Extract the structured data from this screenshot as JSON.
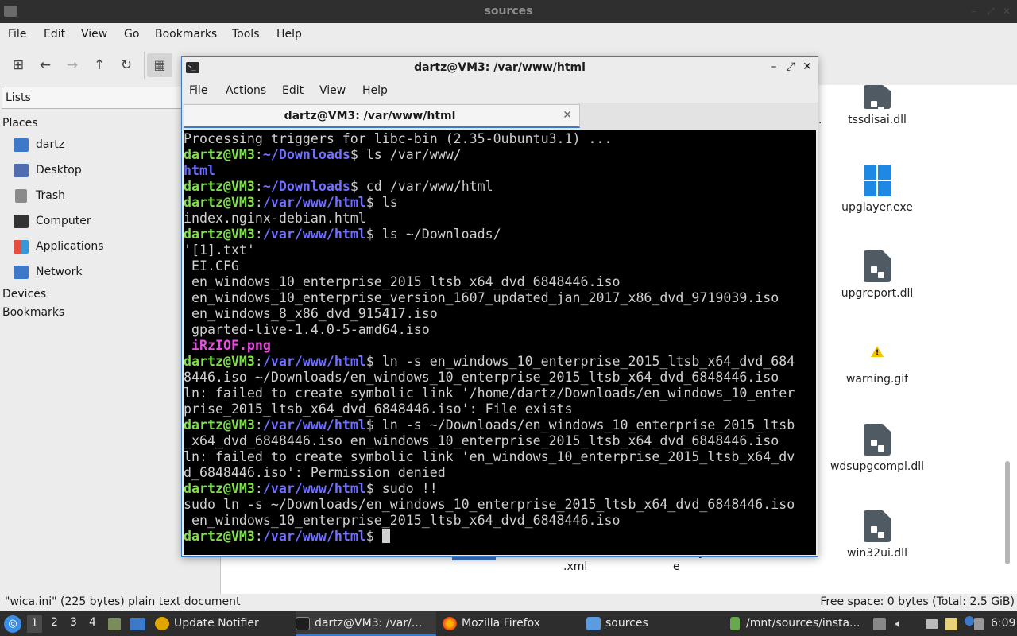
{
  "file_manager": {
    "title": "sources",
    "menu": [
      "File",
      "Edit",
      "View",
      "Go",
      "Bookmarks",
      "Tools",
      "Help"
    ],
    "sidebar": {
      "mode": "Lists",
      "places_heading": "Places",
      "places": [
        {
          "label": "dartz",
          "icon": "home-folder-icon"
        },
        {
          "label": "Desktop",
          "icon": "desktop-icon"
        },
        {
          "label": "Trash",
          "icon": "trash-icon"
        },
        {
          "label": "Computer",
          "icon": "computer-icon"
        },
        {
          "label": "Applications",
          "icon": "applications-icon"
        },
        {
          "label": "Network",
          "icon": "network-icon"
        }
      ],
      "devices_heading": "Devices",
      "bookmarks_heading": "Bookmarks"
    },
    "files": [
      {
        "name": "tssdisai.dll",
        "icon": "dll-file-icon"
      },
      {
        "name": "upglayer.exe",
        "icon": "windows-exe-icon"
      },
      {
        "name": "upgreport.dll",
        "icon": "dll-file-icon"
      },
      {
        "name": "warning.gif",
        "icon": "warning-image-icon"
      },
      {
        "name": "wdsupgcompl.dll",
        "icon": "dll-file-icon"
      },
      {
        "name": "win32ui.dll",
        "icon": "dll-file-icon"
      }
    ],
    "partial_labels": {
      "left_dot": ".",
      "xml": ".xml",
      "e": "e",
      "y": "y"
    },
    "status_left": "\"wica.ini\" (225 bytes) plain text document",
    "status_right": "Free space: 0 bytes (Total: 2.5 GiB)"
  },
  "terminal": {
    "title": "dartz@VM3: /var/www/html",
    "menu": [
      "File",
      "Actions",
      "Edit",
      "View",
      "Help"
    ],
    "tab_label": "dartz@VM3: /var/www/html",
    "lines": [
      [
        {
          "t": "Processing triggers for libc-bin (2.35-0ubuntu3.1) ...",
          "c": ""
        }
      ],
      [
        {
          "t": "dartz@VM3",
          "c": "pu"
        },
        {
          "t": ":",
          "c": ""
        },
        {
          "t": "~/Downloads",
          "c": "pp"
        },
        {
          "t": "$ ls /var/www/",
          "c": ""
        }
      ],
      [
        {
          "t": "html",
          "c": "dir"
        }
      ],
      [
        {
          "t": "dartz@VM3",
          "c": "pu"
        },
        {
          "t": ":",
          "c": ""
        },
        {
          "t": "~/Downloads",
          "c": "pp"
        },
        {
          "t": "$ cd /var/www/html",
          "c": ""
        }
      ],
      [
        {
          "t": "dartz@VM3",
          "c": "pu"
        },
        {
          "t": ":",
          "c": ""
        },
        {
          "t": "/var/www/html",
          "c": "pp"
        },
        {
          "t": "$ ls",
          "c": ""
        }
      ],
      [
        {
          "t": "index.nginx-debian.html",
          "c": ""
        }
      ],
      [
        {
          "t": "dartz@VM3",
          "c": "pu"
        },
        {
          "t": ":",
          "c": ""
        },
        {
          "t": "/var/www/html",
          "c": "pp"
        },
        {
          "t": "$ ls ~/Downloads/",
          "c": ""
        }
      ],
      [
        {
          "t": "'[1].txt'",
          "c": ""
        }
      ],
      [
        {
          "t": " EI.CFG",
          "c": ""
        }
      ],
      [
        {
          "t": " en_windows_10_enterprise_2015_ltsb_x64_dvd_6848446.iso",
          "c": ""
        }
      ],
      [
        {
          "t": " en_windows_10_enterprise_version_1607_updated_jan_2017_x86_dvd_9719039.iso",
          "c": ""
        }
      ],
      [
        {
          "t": " en_windows_8_x86_dvd_915417.iso",
          "c": ""
        }
      ],
      [
        {
          "t": " gparted-live-1.4.0-5-amd64.iso",
          "c": ""
        }
      ],
      [
        {
          "t": " ",
          "c": ""
        },
        {
          "t": "iRzIOF.png",
          "c": "img"
        }
      ],
      [
        {
          "t": "dartz@VM3",
          "c": "pu"
        },
        {
          "t": ":",
          "c": ""
        },
        {
          "t": "/var/www/html",
          "c": "pp"
        },
        {
          "t": "$ ln -s en_windows_10_enterprise_2015_ltsb_x64_dvd_684",
          "c": ""
        }
      ],
      [
        {
          "t": "8446.iso ~/Downloads/en_windows_10_enterprise_2015_ltsb_x64_dvd_6848446.iso",
          "c": ""
        }
      ],
      [
        {
          "t": "ln: failed to create symbolic link '/home/dartz/Downloads/en_windows_10_enter",
          "c": ""
        }
      ],
      [
        {
          "t": "prise_2015_ltsb_x64_dvd_6848446.iso': File exists",
          "c": ""
        }
      ],
      [
        {
          "t": "dartz@VM3",
          "c": "pu"
        },
        {
          "t": ":",
          "c": ""
        },
        {
          "t": "/var/www/html",
          "c": "pp"
        },
        {
          "t": "$ ln -s ~/Downloads/en_windows_10_enterprise_2015_ltsb",
          "c": ""
        }
      ],
      [
        {
          "t": "_x64_dvd_6848446.iso en_windows_10_enterprise_2015_ltsb_x64_dvd_6848446.iso",
          "c": ""
        }
      ],
      [
        {
          "t": "ln: failed to create symbolic link 'en_windows_10_enterprise_2015_ltsb_x64_dv",
          "c": ""
        }
      ],
      [
        {
          "t": "d_6848446.iso': Permission denied",
          "c": ""
        }
      ],
      [
        {
          "t": "dartz@VM3",
          "c": "pu"
        },
        {
          "t": ":",
          "c": ""
        },
        {
          "t": "/var/www/html",
          "c": "pp"
        },
        {
          "t": "$ sudo !!",
          "c": ""
        }
      ],
      [
        {
          "t": "sudo ln -s ~/Downloads/en_windows_10_enterprise_2015_ltsb_x64_dvd_6848446.iso",
          "c": ""
        }
      ],
      [
        {
          "t": " en_windows_10_enterprise_2015_ltsb_x64_dvd_6848446.iso",
          "c": ""
        }
      ],
      [
        {
          "t": "dartz@VM3",
          "c": "pu"
        },
        {
          "t": ":",
          "c": ""
        },
        {
          "t": "/var/www/html",
          "c": "pp"
        },
        {
          "t": "$ ",
          "c": ""
        }
      ]
    ]
  },
  "taskbar": {
    "workspaces": [
      "1",
      "2",
      "3",
      "4"
    ],
    "tasks": [
      {
        "label": "Update Notifier",
        "icon": "update-notifier-icon"
      },
      {
        "label": "dartz@VM3: /var/...",
        "icon": "terminal-icon"
      },
      {
        "label": "Mozilla Firefox",
        "icon": "firefox-icon"
      },
      {
        "label": "sources",
        "icon": "folder-icon"
      },
      {
        "label": "/mnt/sources/insta...",
        "icon": "document-icon"
      }
    ],
    "clock": "6:09"
  },
  "colors": {
    "accent": "#3d79c9",
    "prompt_user": "#7ee14a",
    "prompt_path": "#7171ff",
    "terminal_bg": "#000000"
  }
}
